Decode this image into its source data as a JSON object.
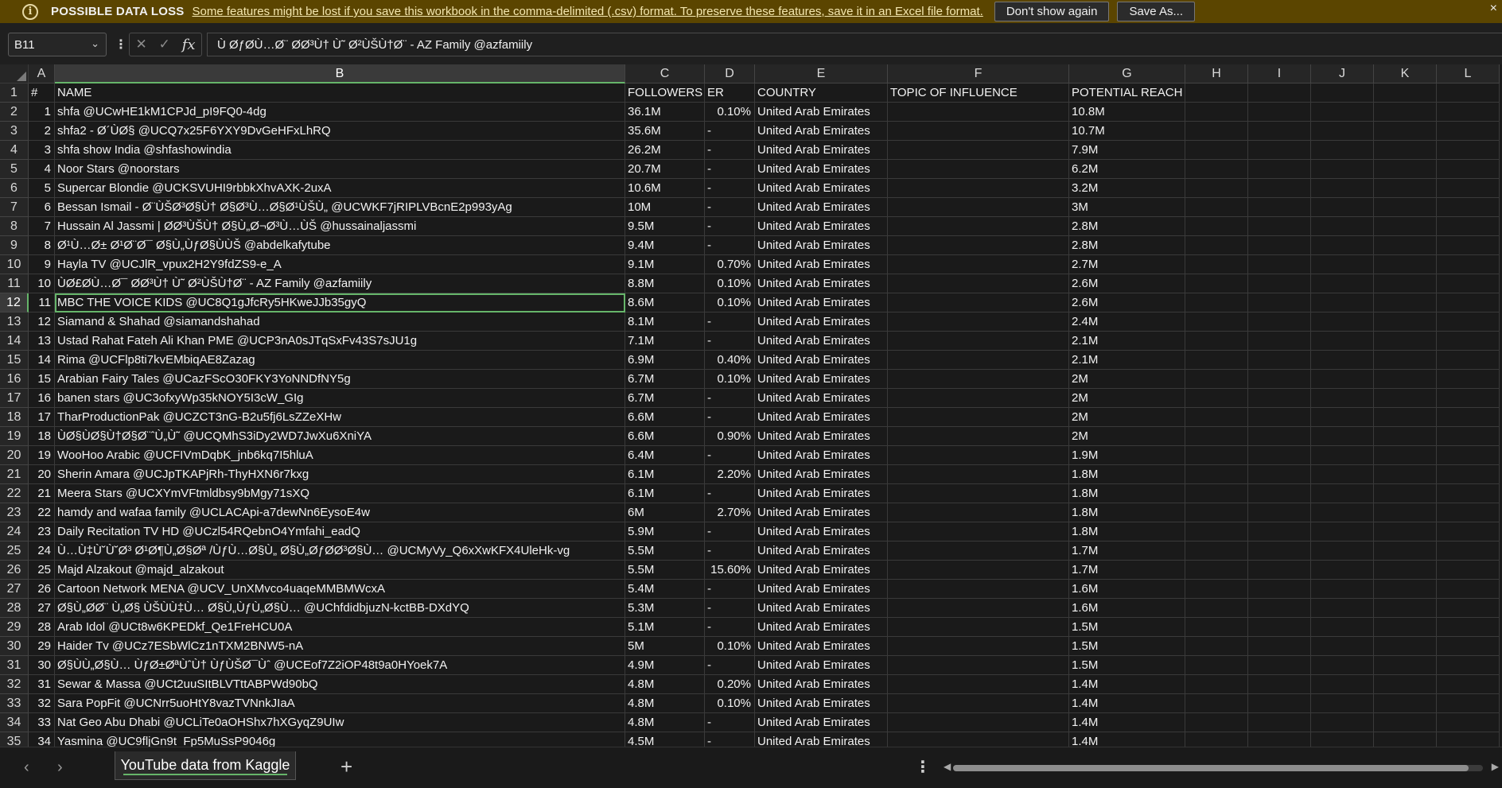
{
  "message_bar": {
    "icon": "info-icon",
    "title": "POSSIBLE DATA LOSS",
    "message": "Some features might be lost if you save this workbook in the comma-delimited (.csv) format. To preserve these features, save it in an Excel file format.",
    "dont_show_label": "Don't show again",
    "save_as_label": "Save As...",
    "close_label": "×"
  },
  "formula_bar": {
    "name_box": "B11",
    "formula": "Ù ØƒØÙ…Ø¨ ØØ³Ù† Ù˜ Ø²ÙŠÙ†Ø¨ - AZ Family @azfamiily"
  },
  "columns": [
    "A",
    "B",
    "C",
    "D",
    "E",
    "F",
    "G",
    "H",
    "I",
    "J",
    "K",
    "L"
  ],
  "header_row": [
    "#",
    "NAME",
    "FOLLOWERS",
    "ER",
    "COUNTRY",
    "TOPIC OF INFLUENCE",
    "POTENTIAL REACH"
  ],
  "rows": [
    [
      "1",
      "shfa @UCwHE1kM1CPJd_pI9FQ0-4dg",
      "36.1M",
      "0.10%",
      "United Arab Emirates",
      "",
      "10.8M"
    ],
    [
      "2",
      "shfa2 - Ø´ÙØ§ @UCQ7x25F6YXY9DvGeHFxLhRQ",
      "35.6M",
      "-",
      "United Arab Emirates",
      "",
      "10.7M"
    ],
    [
      "3",
      "shfa show India @shfashowindia",
      "26.2M",
      "-",
      "United Arab Emirates",
      "",
      "7.9M"
    ],
    [
      "4",
      "Noor Stars @noorstars",
      "20.7M",
      "-",
      "United Arab Emirates",
      "",
      "6.2M"
    ],
    [
      "5",
      "Supercar Blondie @UCKSVUHI9rbbkXhvAXK-2uxA",
      "10.6M",
      "-",
      "United Arab Emirates",
      "",
      "3.2M"
    ],
    [
      "6",
      "Bessan Ismail - Ø¨ÙŠØ³Ø§Ù† Ø§Ø³Ù…Ø§Ø¹ÙŠÙ„ @UCWKF7jRIPLVBcnE2p993yAg",
      "10M",
      "-",
      "United Arab Emirates",
      "",
      "3M"
    ],
    [
      "7",
      "Hussain Al Jassmi | Ø­Ø³ÙŠÙ† Ø§Ù„Ø¬Ø³Ù…ÙŠ @hussainaljassmi",
      "9.5M",
      "-",
      "United Arab Emirates",
      "",
      "2.8M"
    ],
    [
      "8",
      "Ø¹Ù…Ø± Ø¹Ø¨Ø¯ Ø§Ù„ÙƒØ§ÙÙŠ @abdelkafytube",
      "9.4M",
      "-",
      "United Arab Emirates",
      "",
      "2.8M"
    ],
    [
      "9",
      "Hayla TV @UCJlR_vpux2H2Y9fdZS9-e_A",
      "9.1M",
      "0.70%",
      "United Arab Emirates",
      "",
      "2.7M"
    ],
    [
      "10",
      "ÙØ£Ø­Ù…Ø¯ Ø­Ø³Ù† Ù˜ Ø²ÙŠÙ†Ø¨ - AZ Family @azfamiily",
      "8.8M",
      "0.10%",
      "United Arab Emirates",
      "",
      "2.6M"
    ],
    [
      "11",
      "MBC THE VOICE KIDS @UC8Q1gJfcRy5HKweJJb35gyQ",
      "8.6M",
      "0.10%",
      "United Arab Emirates",
      "",
      "2.6M"
    ],
    [
      "12",
      "Siamand & Shahad @siamandshahad",
      "8.1M",
      "-",
      "United Arab Emirates",
      "",
      "2.4M"
    ],
    [
      "13",
      "Ustad Rahat Fateh Ali Khan PME @UCP3nA0sJTqSxFv43S7sJU1g",
      "7.1M",
      "-",
      "United Arab Emirates",
      "",
      "2.1M"
    ],
    [
      "14",
      "Rima @UCFlp8ti7kvEMbiqAE8Zazag",
      "6.9M",
      "0.40%",
      "United Arab Emirates",
      "",
      "2.1M"
    ],
    [
      "15",
      "Arabian Fairy Tales @UCazFScO30FKY3YoNNDfNY5g",
      "6.7M",
      "0.10%",
      "United Arab Emirates",
      "",
      "2M"
    ],
    [
      "16",
      "banen stars @UC3ofxyWp35kNOY5I3cW_GIg",
      "6.7M",
      "-",
      "United Arab Emirates",
      "",
      "2M"
    ],
    [
      "17",
      "TharProductionPak @UCZCT3nG-B2u5fj6LsZZeXHw",
      "6.6M",
      "-",
      "United Arab Emirates",
      "",
      "2M"
    ],
    [
      "18",
      "ÙØ§ÙØ§Ù†Ø§Ø¨ˆÙ„Ù˜ @UCQMhS3iDy2WD7JwXu6XniYA",
      "6.6M",
      "0.90%",
      "United Arab Emirates",
      "",
      "2M"
    ],
    [
      "19",
      "WooHoo Arabic @UCFIVmDqbK_jnb6kq7I5hluA",
      "6.4M",
      "-",
      "United Arab Emirates",
      "",
      "1.9M"
    ],
    [
      "20",
      "Sherin Amara @UCJpTKAPjRh-ThyHXN6r7kxg",
      "6.1M",
      "2.20%",
      "United Arab Emirates",
      "",
      "1.8M"
    ],
    [
      "21",
      "Meera Stars @UCXYmVFtmldbsy9bMgy71sXQ",
      "6.1M",
      "-",
      "United Arab Emirates",
      "",
      "1.8M"
    ],
    [
      "22",
      "hamdy and wafaa family @UCLACApi-a7dewNn6EysoE4w",
      "6M",
      "2.70%",
      "United Arab Emirates",
      "",
      "1.8M"
    ],
    [
      "23",
      "Daily Recitation TV HD @UCzl54RQebnO4Ymfahi_eadQ",
      "5.9M",
      "-",
      "United Arab Emirates",
      "",
      "1.8M"
    ],
    [
      "24",
      "Ù…Ù‡Ù˘Ù˘Ø³ Ø¹Ø¶Ù„Ø§Øª /ÙƒÙ…Ø§Ù„ Ø§Ù„ØƒØ­Ø³Ø§Ù… @UCMyVy_Q6xXwKFX4UleHk-vg",
      "5.5M",
      "-",
      "United Arab Emirates",
      "",
      "1.7M"
    ],
    [
      "25",
      "Majd Alzakout @majd_alzakout",
      "5.5M",
      "15.60%",
      "United Arab Emirates",
      "",
      "1.7M"
    ],
    [
      "26",
      "Cartoon Network MENA @UCV_UnXMvco4uaqeMMBMWcxA",
      "5.4M",
      "-",
      "United Arab Emirates",
      "",
      "1.6M"
    ],
    [
      "27",
      "Ø§Ù„Ø­Ø¨ Ù„Ø§ ÙŠÙÙ‡Ù… Ø§Ù„ÙƒÙ„Ø§Ù… @UChfdidbjuzN-kctBB-DXdYQ",
      "5.3M",
      "-",
      "United Arab Emirates",
      "",
      "1.6M"
    ],
    [
      "28",
      "Arab Idol @UCt8w6KPEDkf_Qe1FreHCU0A",
      "5.1M",
      "-",
      "United Arab Emirates",
      "",
      "1.5M"
    ],
    [
      "29",
      "Haider Tv @UCz7ESbWlCz1nTXM2BNW5-nA",
      "5M",
      "0.10%",
      "United Arab Emirates",
      "",
      "1.5M"
    ],
    [
      "30",
      "Ø§ÙÙ„Ø§Ù… ÙƒØ±ØªÙˆÙ† ÙƒÙŠØ¯Ùˆ @UCEof7Z2iOP48t9a0HYoek7A",
      "4.9M",
      "-",
      "United Arab Emirates",
      "",
      "1.5M"
    ],
    [
      "31",
      "Sewar & Massa @UCt2uuSItBLVTttABPWd90bQ",
      "4.8M",
      "0.20%",
      "United Arab Emirates",
      "",
      "1.4M"
    ],
    [
      "32",
      "Sara PopFit @UCNrr5uoHtY8vazTVNnkJIaA",
      "4.8M",
      "0.10%",
      "United Arab Emirates",
      "",
      "1.4M"
    ],
    [
      "33",
      "Nat Geo Abu Dhabi @UCLiTe0aOHShx7hXGyqZ9UIw",
      "4.8M",
      "-",
      "United Arab Emirates",
      "",
      "1.4M"
    ],
    [
      "34",
      "Yasmina @UC9fljGn9t_Fp5MuSsP9046g",
      "4.5M",
      "-",
      "United Arab Emirates",
      "",
      "1.4M"
    ]
  ],
  "selected_row_index": 10,
  "sheet_tab": {
    "label": "YouTube data from Kaggle",
    "add_label": "+",
    "prev_label": "‹",
    "next_label": "›"
  },
  "colors": {
    "message_bar_bg": "#5b4500",
    "selection_green": "#66b56a",
    "grid_bg": "#1a1a1a"
  }
}
